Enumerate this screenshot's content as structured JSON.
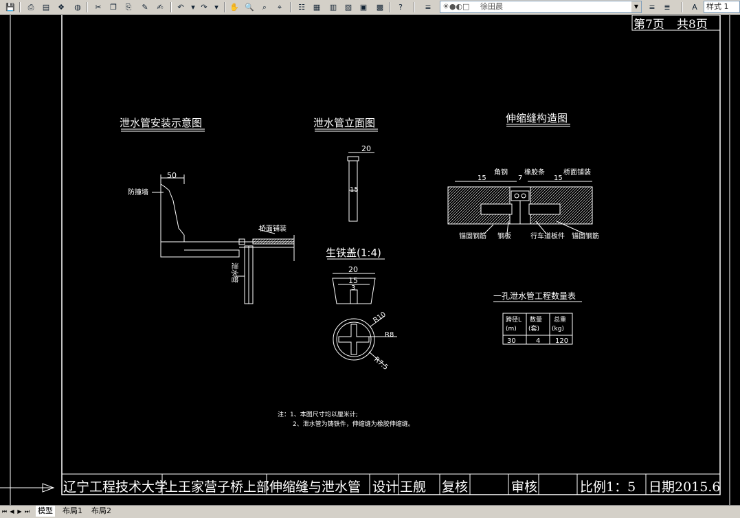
{
  "toolbar": {
    "layer_name": "徐田晨",
    "text_style": "样式 1"
  },
  "drawing": {
    "page_info": {
      "page": "第7页",
      "total": "共8页"
    },
    "install_title": "泄水管安装示意图",
    "install_labels": {
      "dim_50": "50",
      "wall": "防撞墙",
      "paving": "桥面铺装",
      "pipe": "泄水管"
    },
    "elevation_title": "泄水管立面图",
    "elevation_labels": {
      "dim_20": "20",
      "dim_15": "15"
    },
    "cover_title": "生铁盖(1:4)",
    "cover_labels": {
      "dim_20": "20",
      "dim_15": "15",
      "dim_3": "3",
      "r10": "R10",
      "r8": "R8",
      "r75": "R7.5"
    },
    "joint_title": "伸缩缝构造图",
    "joint_labels": {
      "angle_steel": "角钢",
      "rubber_strip": "橡胶条",
      "paving": "桥面铺装",
      "dim_15a": "15",
      "dim_7": "7",
      "dim_15b": "15",
      "anchor_left": "锚固钢筋",
      "steel_plate": "钢板",
      "deck_slab": "行车道板件",
      "anchor_right": "锚固钢筋"
    },
    "table": {
      "title": "一孔泄水管工程数量表",
      "headers": [
        {
          "line1": "跨径L",
          "line2": "(m)"
        },
        {
          "line1": "数量",
          "line2": "(套)"
        },
        {
          "line1": "总重",
          "line2": "(kg)"
        }
      ],
      "row": [
        "30",
        "4",
        "120"
      ]
    },
    "notes": [
      "注：1、本图尺寸均以厘米计;",
      "2、泄水管为铸铁件，伸缩缝为橡胶伸缩缝。"
    ],
    "title_block": {
      "school": "辽宁工程技术大学",
      "project": "上王家营子桥上部",
      "drawing_name": "伸缩缝与泄水管",
      "design_label": "设计",
      "designer": "王舰",
      "review_label": "复核",
      "approve_label": "审核",
      "scale": "比例1：5",
      "date": "日期2015.6"
    }
  },
  "layout_tabs": {
    "model": "模型",
    "layout1": "布局1",
    "layout2": "布局2"
  },
  "colors": {
    "background": "#000000",
    "lines": "#ffffff",
    "toolbar": "#d4d0c8"
  }
}
